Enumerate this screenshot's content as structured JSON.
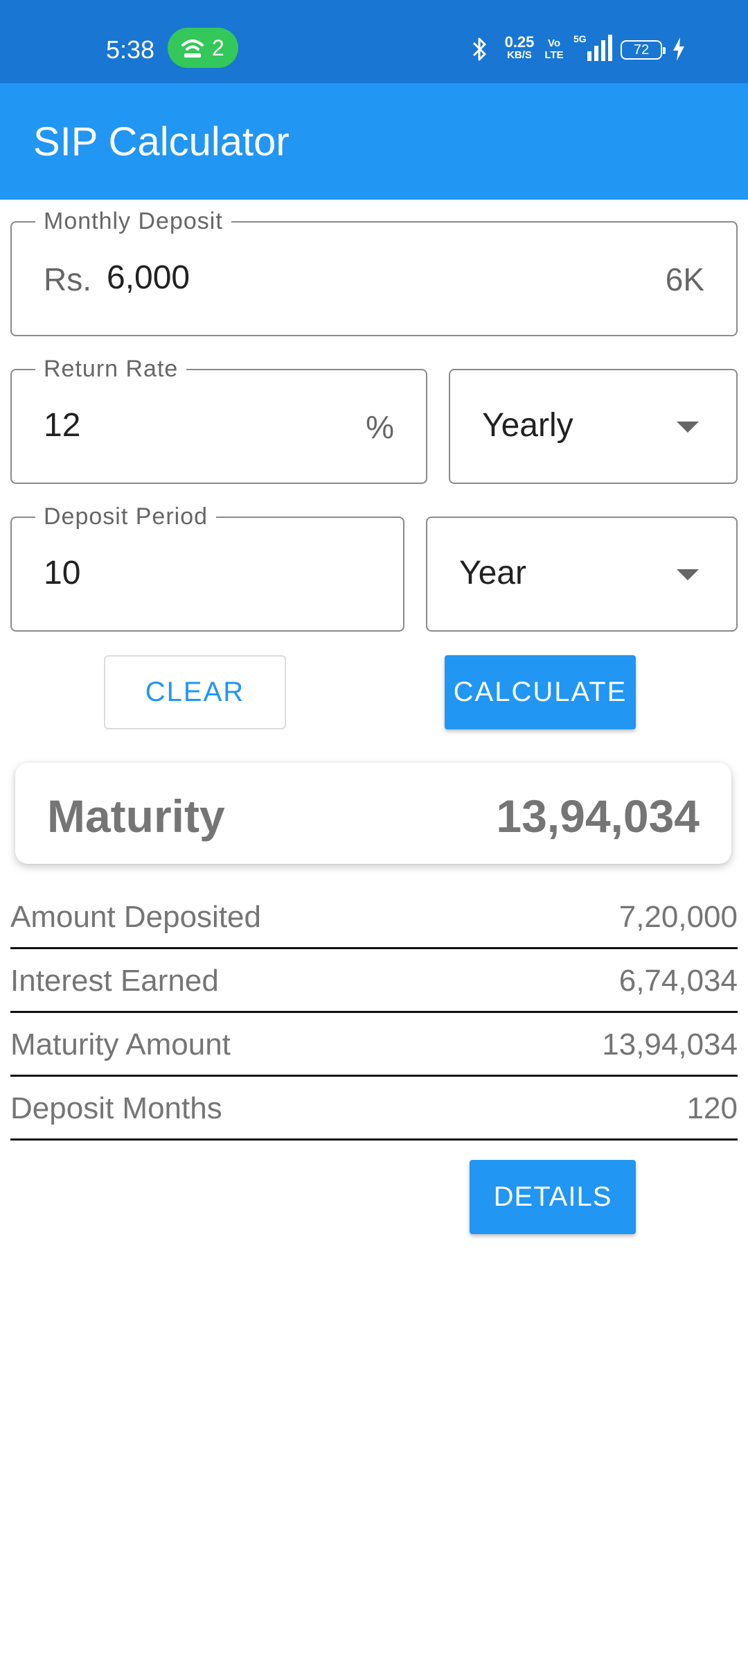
{
  "status_bar": {
    "time": "5:38",
    "hotspot_count": "2",
    "net_speed_value": "0.25",
    "net_speed_unit": "KB/S",
    "volte_top": "Vo",
    "volte_bottom": "LTE",
    "network": "5G",
    "battery": "72"
  },
  "app_bar": {
    "title": "SIP Calculator"
  },
  "monthly_deposit": {
    "label": "Monthly Deposit",
    "prefix": "Rs.",
    "value": "6,000",
    "suffix": "6K"
  },
  "return_rate": {
    "label": "Return Rate",
    "value": "12",
    "suffix": "%",
    "frequency": "Yearly"
  },
  "deposit_period": {
    "label": "Deposit Period",
    "value": "10",
    "unit": "Year"
  },
  "buttons": {
    "clear": "CLEAR",
    "calculate": "CALCULATE",
    "details": "DETAILS"
  },
  "maturity": {
    "label": "Maturity",
    "value": "13,94,034"
  },
  "summary": [
    {
      "label": "Amount Deposited",
      "value": "7,20,000"
    },
    {
      "label": "Interest Earned",
      "value": "6,74,034"
    },
    {
      "label": "Maturity Amount",
      "value": "13,94,034"
    },
    {
      "label": "Deposit Months",
      "value": "120"
    }
  ],
  "colors": {
    "status_bar": "#1976d2",
    "app_bar": "#2196f3",
    "accent": "#2196f3",
    "hotspot_pill": "#34c759"
  }
}
